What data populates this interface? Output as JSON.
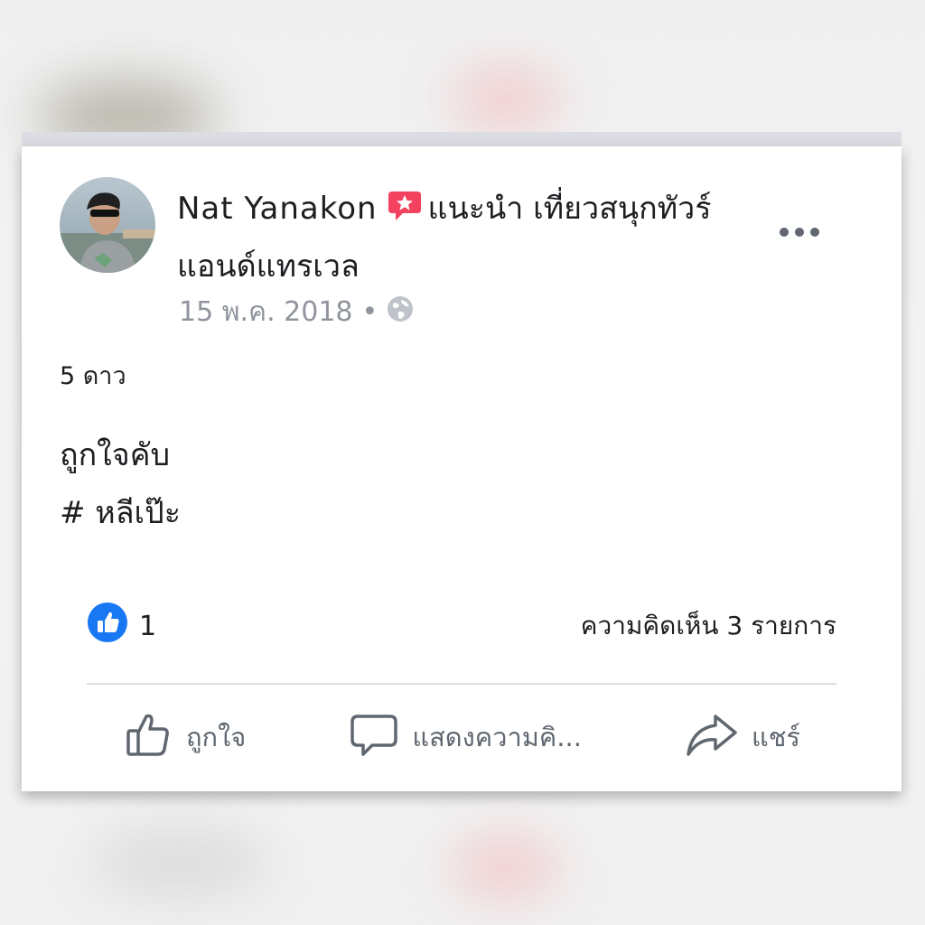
{
  "post": {
    "author": "Nat Yanakon",
    "recommend_text": "แนะนำ เที่ยวสนุกทัวร์",
    "page_name_line2": "แอนด์แทรเวล",
    "date": "15 พ.ค. 2018",
    "separator": "•",
    "rating": "5 ดาว",
    "body_line1": "ถูกใจคับ",
    "body_line2": "# หลีเป๊ะ"
  },
  "stats": {
    "like_count": "1",
    "comments": "ความคิดเห็น 3 รายการ"
  },
  "actions": {
    "like": "ถูกใจ",
    "comment": "แสดงความคิ...",
    "share": "แชร์"
  },
  "icons": {
    "recommend": "recommend-star-icon",
    "audience": "globe-icon",
    "like_reaction": "thumbs-up-icon",
    "more": "more-options-icon"
  },
  "colors": {
    "recommend_red": "#f3425f",
    "like_blue": "#1877f2",
    "muted_text": "#90949c",
    "action_gray": "#606770"
  }
}
